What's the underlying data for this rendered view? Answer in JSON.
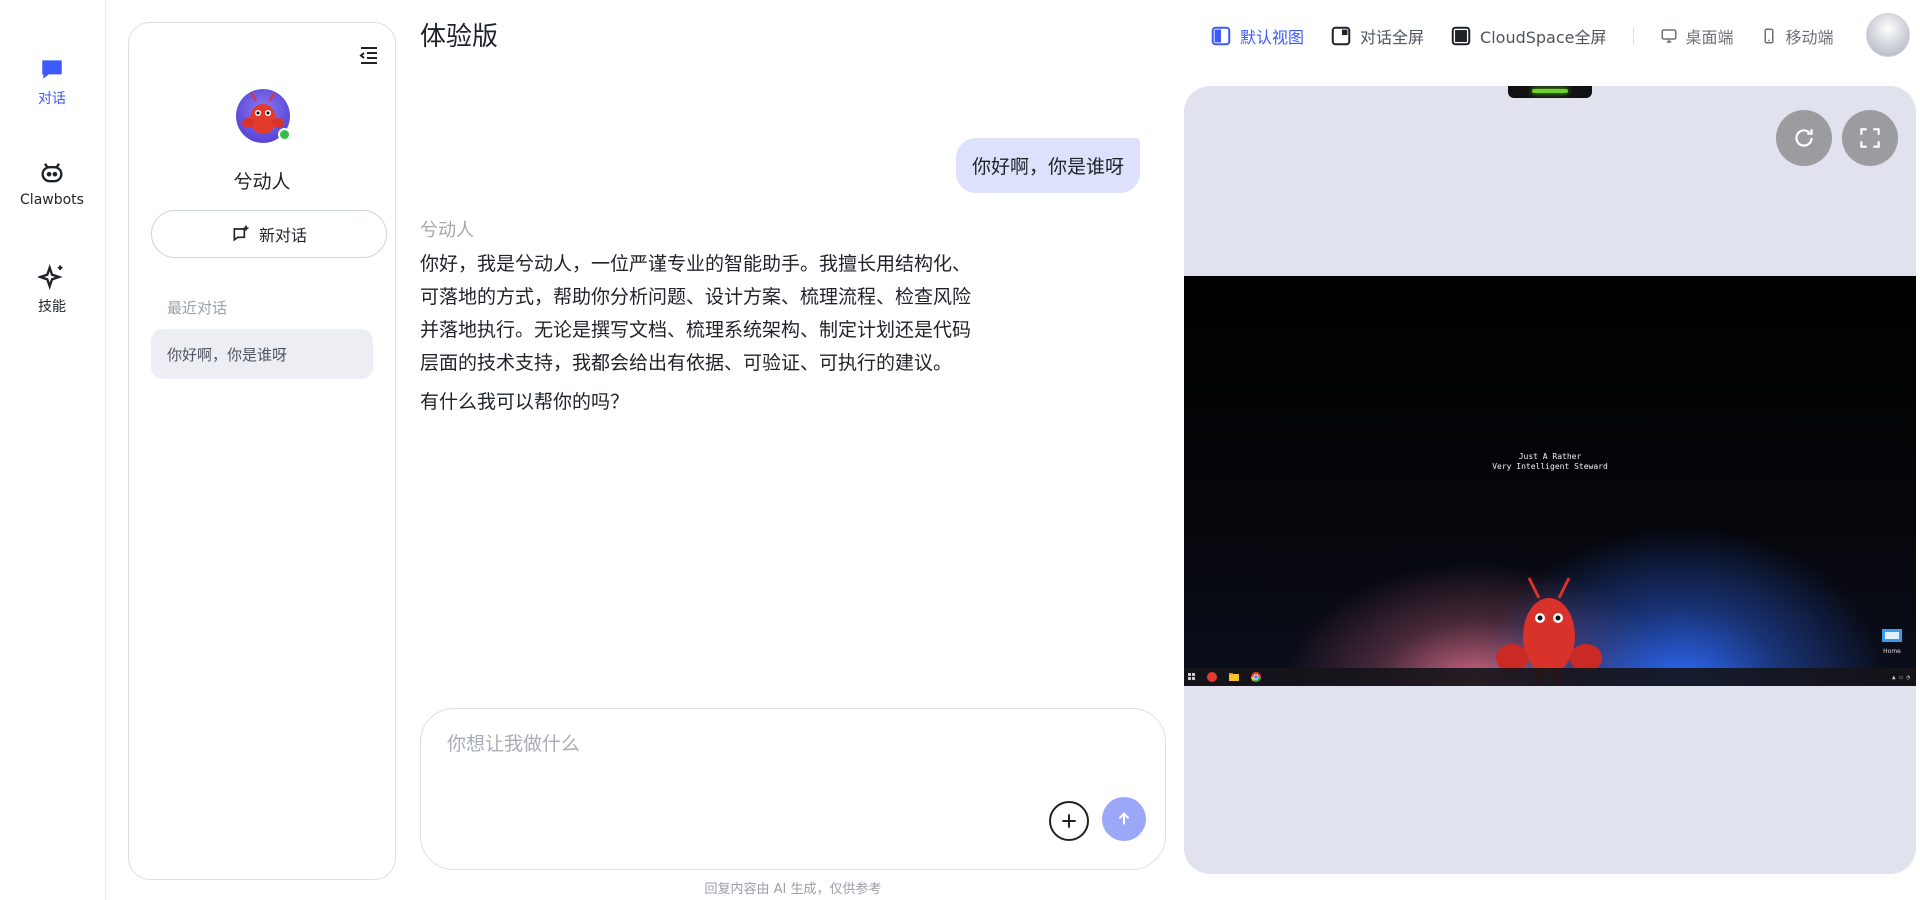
{
  "nav": {
    "items": [
      {
        "label": "对话",
        "icon": "chat-bubble-icon",
        "active": true
      },
      {
        "label": "Clawbots",
        "icon": "bot-icon",
        "active": false
      },
      {
        "label": "技能",
        "icon": "sparkle-icon",
        "active": false
      }
    ]
  },
  "sidebar": {
    "agent_name": "兮动人",
    "new_chat_label": "新对话",
    "recent_title": "最近对话",
    "recent_items": [
      {
        "label": "你好啊，你是谁呀"
      }
    ]
  },
  "header": {
    "title": "体验版"
  },
  "toolbar": {
    "items": [
      {
        "label": "默认视图",
        "icon": "split-view-icon",
        "active": true
      },
      {
        "label": "对话全屏",
        "icon": "chat-fullscreen-icon",
        "active": false
      },
      {
        "label": "CloudSpace全屏",
        "icon": "cloudspace-fullscreen-icon",
        "active": false
      },
      {
        "label": "桌面端",
        "icon": "desktop-icon",
        "active": false
      },
      {
        "label": "移动端",
        "icon": "mobile-icon",
        "active": false
      }
    ]
  },
  "chat": {
    "user_message": "你好啊，你是谁呀",
    "bot_name": "兮动人",
    "bot_paragraphs": [
      "你好，我是兮动人，一位严谨专业的智能助手。我擅长用结构化、可落地的方式，帮助你分析问题、设计方案、梳理流程、检查风险并落地执行。无论是撰写文档、梳理系统架构、制定计划还是代码层面的技术支持，我都会给出有依据、可验证、可执行的建议。",
      "有什么我可以帮你的吗？"
    ]
  },
  "composer": {
    "placeholder": "你想让我做什么",
    "value": ""
  },
  "disclaimer": "回复内容由 AI 生成，仅供参考",
  "cloudspace": {
    "desktop_text_line1": "Just A Rather",
    "desktop_text_line2": "Very Intelligent Steward",
    "desktop_icon_label": "Home"
  },
  "colors": {
    "accent": "#3d5afe",
    "user_bubble": "#dde1fb",
    "send_button": "#9aa8f7",
    "panel_bg": "#e0e3ee",
    "online": "#2fbf4a"
  }
}
